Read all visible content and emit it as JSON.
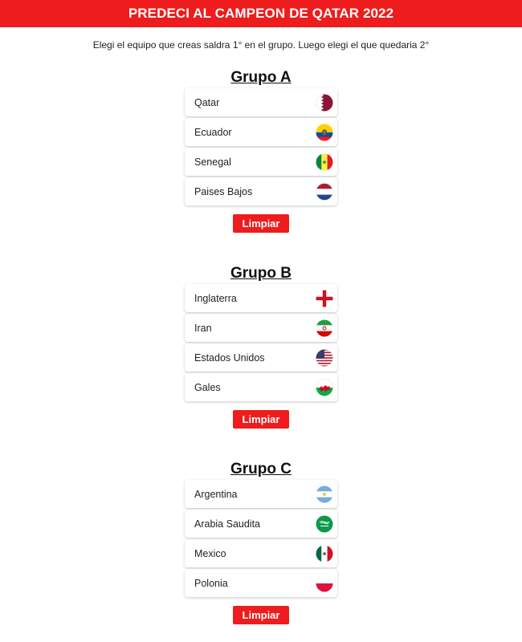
{
  "header": {
    "title": "PREDECI AL CAMPEON DE QATAR 2022"
  },
  "subtitle": "Elegi el equipo que creas saldra 1° en el grupo. Luego elegi el que quedaria 2°",
  "groups": [
    {
      "title": "Grupo A",
      "clear_label": "Limpiar",
      "teams": [
        {
          "name": "Qatar",
          "flag_icon": "qatar-flag-icon"
        },
        {
          "name": "Ecuador",
          "flag_icon": "ecuador-flag-icon"
        },
        {
          "name": "Senegal",
          "flag_icon": "senegal-flag-icon"
        },
        {
          "name": "Paises Bajos",
          "flag_icon": "netherlands-flag-icon"
        }
      ]
    },
    {
      "title": "Grupo B",
      "clear_label": "Limpiar",
      "teams": [
        {
          "name": "Inglaterra",
          "flag_icon": "england-flag-icon"
        },
        {
          "name": "Iran",
          "flag_icon": "iran-flag-icon"
        },
        {
          "name": "Estados Unidos",
          "flag_icon": "usa-flag-icon"
        },
        {
          "name": "Gales",
          "flag_icon": "wales-flag-icon"
        }
      ]
    },
    {
      "title": "Grupo C",
      "clear_label": "Limpiar",
      "teams": [
        {
          "name": "Argentina",
          "flag_icon": "argentina-flag-icon"
        },
        {
          "name": "Arabia Saudita",
          "flag_icon": "saudi-arabia-flag-icon"
        },
        {
          "name": "Mexico",
          "flag_icon": "mexico-flag-icon"
        },
        {
          "name": "Polonia",
          "flag_icon": "poland-flag-icon"
        }
      ]
    }
  ],
  "colors": {
    "accent": "#ee1c1c"
  }
}
